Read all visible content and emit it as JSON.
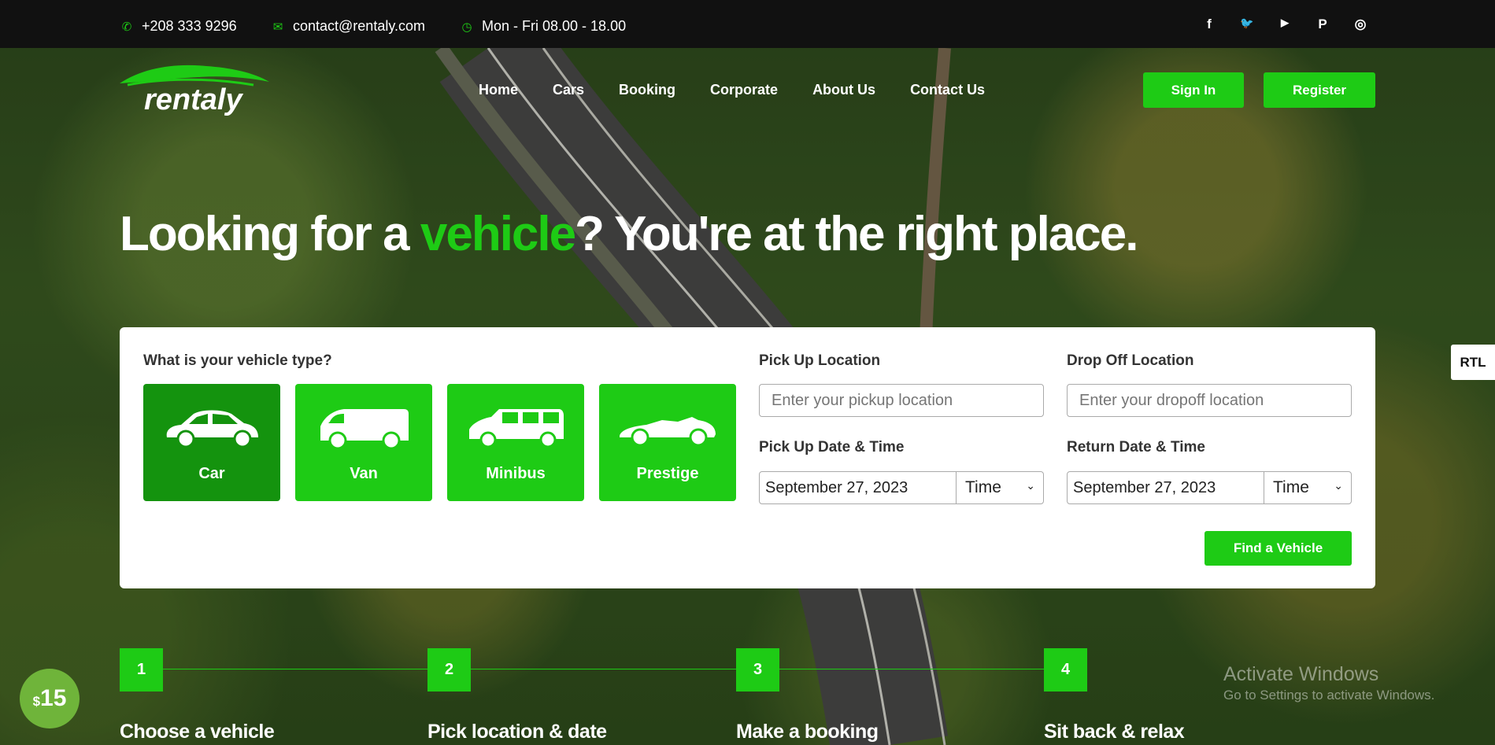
{
  "topbar": {
    "phone": "+208 333 9296",
    "email": "contact@rentaly.com",
    "hours": "Mon - Fri 08.00 - 18.00",
    "social": [
      {
        "icon": "facebook-icon",
        "glyph": "f"
      },
      {
        "icon": "twitter-icon",
        "glyph": "🐦"
      },
      {
        "icon": "youtube-icon",
        "glyph": "▶"
      },
      {
        "icon": "pinterest-icon",
        "glyph": "P"
      },
      {
        "icon": "instagram-icon",
        "glyph": "◎"
      }
    ]
  },
  "header": {
    "logo_text": "rentaly",
    "nav": [
      "Home",
      "Cars",
      "Booking",
      "Corporate",
      "About Us",
      "Contact Us"
    ],
    "signin_label": "Sign In",
    "register_label": "Register"
  },
  "hero": {
    "title_prefix": "Looking for a ",
    "title_accent": "vehicle",
    "title_suffix": "? You're at the right place."
  },
  "search": {
    "vehicle_type_label": "What is your vehicle type?",
    "vehicle_types": [
      {
        "label": "Car",
        "active": true
      },
      {
        "label": "Van",
        "active": false
      },
      {
        "label": "Minibus",
        "active": false
      },
      {
        "label": "Prestige",
        "active": false
      }
    ],
    "pickup_label": "Pick Up Location",
    "pickup_placeholder": "Enter your pickup location",
    "dropoff_label": "Drop Off Location",
    "dropoff_placeholder": "Enter your dropoff location",
    "pickup_dt_label": "Pick Up Date & Time",
    "pickup_date": "September 27, 2023",
    "pickup_time": "Time",
    "return_dt_label": "Return Date & Time",
    "return_date": "September 27, 2023",
    "return_time": "Time",
    "find_label": "Find a Vehicle"
  },
  "steps": [
    {
      "num": "1",
      "title": "Choose a vehicle"
    },
    {
      "num": "2",
      "title": "Pick location & date"
    },
    {
      "num": "3",
      "title": "Make a booking"
    },
    {
      "num": "4",
      "title": "Sit back & relax"
    }
  ],
  "misc": {
    "rtl_label": "RTL",
    "price_currency": "$",
    "price_amount": "15",
    "watermark_line1": "Activate Windows",
    "watermark_line2": "Go to Settings to activate Windows."
  },
  "colors": {
    "accent": "#1ecb15",
    "accent_dark": "#14930e",
    "topbar": "#111111"
  }
}
